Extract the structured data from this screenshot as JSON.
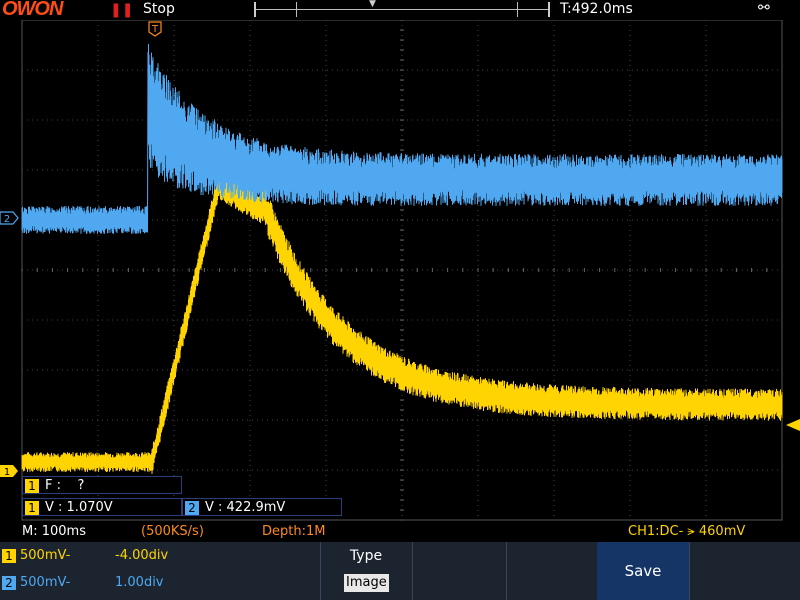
{
  "header": {
    "brand": "OWON",
    "pause_icon": "pause-icon",
    "run_state": "Stop",
    "trigger_time": "T:492.0ms",
    "usb_icon": "usb-icon"
  },
  "markers": {
    "trigger_marker": "T",
    "ch1_offset_marker": "1",
    "ch2_offset_marker": "2"
  },
  "measurements": {
    "ch1_freq": {
      "channel": "1",
      "text": "F :    ?"
    },
    "ch1_volt": {
      "channel": "1",
      "text": "V : 1.070V"
    },
    "ch2_volt": {
      "channel": "2",
      "text": "V : 422.9mV"
    }
  },
  "status": {
    "timebase": "M: 100ms",
    "sample_rate": "(500KS/s)",
    "depth": "Depth:1M",
    "trigger_info": "CH1:DC- ⪫ 460mV"
  },
  "channels": [
    {
      "num": "1",
      "scale": "500mV-",
      "offset": "-4.00div",
      "color": "#ffd400"
    },
    {
      "num": "2",
      "scale": "500mV-",
      "offset": "1.00div",
      "color": "#4fa8f0"
    }
  ],
  "menu": {
    "type_label": "Type",
    "type_value": "Image",
    "save_label": "Save"
  },
  "colors": {
    "ch1": "#ffd400",
    "ch2": "#4fa8f0",
    "brand": "#ff4d17",
    "menu_bg": "#1c2430",
    "save_bg": "#143566"
  }
}
